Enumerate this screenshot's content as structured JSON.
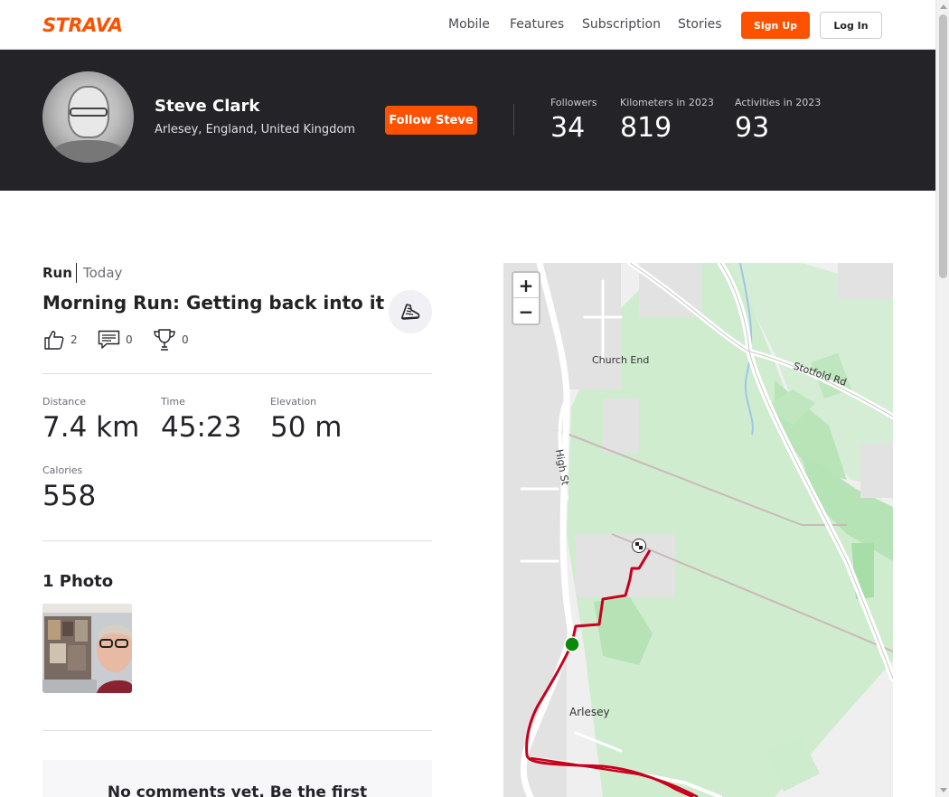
{
  "nav": {
    "brand": "STRAVA",
    "links": [
      "Mobile",
      "Features",
      "Subscription",
      "Stories"
    ],
    "signup_label": "Sign Up",
    "login_label": "Log In",
    "brand_color": "#fc5200"
  },
  "athlete": {
    "name": "Steve Clark",
    "location": "Arlesey, England, United Kingdom",
    "follow_label": "Follow Steve",
    "stats": [
      {
        "label": "Followers",
        "value": "34"
      },
      {
        "label": "Kilometers in 2023",
        "value": "819"
      },
      {
        "label": "Activities in 2023",
        "value": "93"
      }
    ]
  },
  "activity": {
    "type": "Run",
    "date": "Today",
    "title": "Morning Run: Getting back into it",
    "social": {
      "kudos": "2",
      "comments": "0",
      "achievements": "0"
    },
    "metrics": [
      {
        "label": "Distance",
        "value": "7.4 km"
      },
      {
        "label": "Time",
        "value": "45:23"
      },
      {
        "label": "Elevation",
        "value": "50 m"
      },
      {
        "label": "Calories",
        "value": "558"
      }
    ],
    "photos_heading": "1 Photo",
    "comments_text": "No comments yet. Be the first"
  },
  "map": {
    "labels": {
      "church_end": "Church End",
      "stotfold_rd": "Stotfold Rd",
      "high_st": "High St",
      "arlesey": "Arlesey"
    },
    "zoom_in": "+",
    "zoom_out": "−",
    "route_color": "#c8001e",
    "start_color": "#0a8a0a"
  }
}
